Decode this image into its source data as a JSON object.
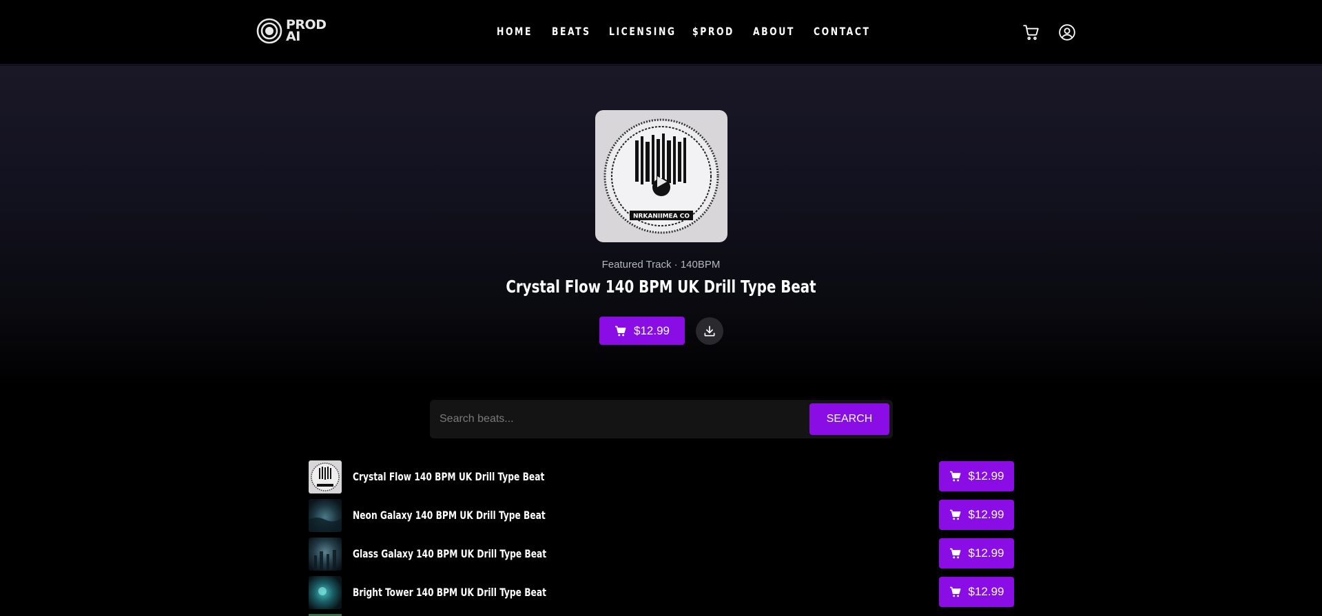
{
  "brand": {
    "line1": "PROD",
    "line2": "AI"
  },
  "nav": [
    "HOME",
    "BEATS",
    "LICENSING",
    "$PROD",
    "ABOUT",
    "CONTACT"
  ],
  "header_icons": [
    "cart-icon",
    "user-circle-icon"
  ],
  "featured": {
    "meta": "Featured Track · 140BPM",
    "title": "Crystal Flow 140 BPM UK Drill Type Beat",
    "price": "$12.99",
    "cover_label": "NRKANIIMEA CO"
  },
  "search": {
    "placeholder": "Search beats...",
    "button": "SEARCH"
  },
  "tracks": [
    {
      "title": "Crystal Flow 140 BPM UK Drill Type Beat",
      "price": "$12.99"
    },
    {
      "title": "Neon Galaxy 140 BPM UK Drill Type Beat",
      "price": "$12.99"
    },
    {
      "title": "Glass Galaxy 140 BPM UK Drill Type Beat",
      "price": "$12.99"
    },
    {
      "title": "Bright Tower 140 BPM UK Drill Type Beat",
      "price": "$12.99"
    }
  ],
  "colors": {
    "accent": "#8a0de6",
    "background": "#000000",
    "hero_top": "#1a1826"
  }
}
